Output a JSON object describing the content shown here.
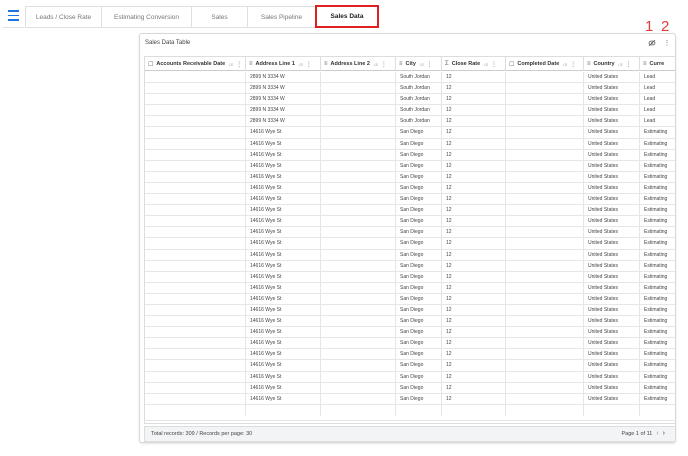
{
  "tabs": [
    {
      "label": "Leads / Close Rate",
      "active": false
    },
    {
      "label": "Estimating Conversion",
      "active": false
    },
    {
      "label": "Sales",
      "active": false
    },
    {
      "label": "Sales Pipeline",
      "active": false
    },
    {
      "label": "Sales Data",
      "active": true
    }
  ],
  "annotations": {
    "first": "1",
    "second": "2"
  },
  "card": {
    "title": "Sales Data Table",
    "visibility_icon": "eye-slash-icon",
    "more_icon": "kebab-icon"
  },
  "table": {
    "columns": [
      {
        "label": "Accounts Receivable Date",
        "icon": "☐",
        "sortable": true
      },
      {
        "label": "Address Line 1",
        "icon": "≡",
        "sortable": true
      },
      {
        "label": "Address Line 2",
        "icon": "≡",
        "sortable": true
      },
      {
        "label": "City",
        "icon": "≡",
        "sortable": true
      },
      {
        "label": "Close Rate",
        "icon": "Σ",
        "sortable": true
      },
      {
        "label": "Completed Date",
        "icon": "☐",
        "sortable": true
      },
      {
        "label": "Country",
        "icon": "≡",
        "sortable": true
      },
      {
        "label": "Curre",
        "icon": "≡",
        "sortable": false
      }
    ],
    "sort_glyph": "↓≡",
    "kebab_glyph": "⋮",
    "rows": [
      [
        "",
        "2899 N 3334 W",
        "",
        "South Jordan",
        "12",
        "",
        "United States",
        "Lead"
      ],
      [
        "",
        "2899 N 3334 W",
        "",
        "South Jordan",
        "12",
        "",
        "United States",
        "Lead"
      ],
      [
        "",
        "2899 N 3334 W",
        "",
        "South Jordan",
        "12",
        "",
        "United States",
        "Lead"
      ],
      [
        "",
        "2899 N 3334 W",
        "",
        "South Jordan",
        "12",
        "",
        "United States",
        "Lead"
      ],
      [
        "",
        "2899 N 3334 W",
        "",
        "South Jordan",
        "12",
        "",
        "United States",
        "Lead"
      ],
      [
        "",
        "14616 Wye St",
        "",
        "San Diego",
        "12",
        "",
        "United States",
        "Estimating"
      ],
      [
        "",
        "14616 Wye St",
        "",
        "San Diego",
        "12",
        "",
        "United States",
        "Estimating"
      ],
      [
        "",
        "14616 Wye St",
        "",
        "San Diego",
        "12",
        "",
        "United States",
        "Estimating"
      ],
      [
        "",
        "14616 Wye St",
        "",
        "San Diego",
        "12",
        "",
        "United States",
        "Estimating"
      ],
      [
        "",
        "14616 Wye St",
        "",
        "San Diego",
        "12",
        "",
        "United States",
        "Estimating"
      ],
      [
        "",
        "14616 Wye St",
        "",
        "San Diego",
        "12",
        "",
        "United States",
        "Estimating"
      ],
      [
        "",
        "14616 Wye St",
        "",
        "San Diego",
        "12",
        "",
        "United States",
        "Estimating"
      ],
      [
        "",
        "14616 Wye St",
        "",
        "San Diego",
        "12",
        "",
        "United States",
        "Estimating"
      ],
      [
        "",
        "14616 Wye St",
        "",
        "San Diego",
        "12",
        "",
        "United States",
        "Estimating"
      ],
      [
        "",
        "14616 Wye St",
        "",
        "San Diego",
        "12",
        "",
        "United States",
        "Estimating"
      ],
      [
        "",
        "14616 Wye St",
        "",
        "San Diego",
        "12",
        "",
        "United States",
        "Estimating"
      ],
      [
        "",
        "14616 Wye St",
        "",
        "San Diego",
        "12",
        "",
        "United States",
        "Estimating"
      ],
      [
        "",
        "14616 Wye St",
        "",
        "San Diego",
        "12",
        "",
        "United States",
        "Estimating"
      ],
      [
        "",
        "14616 Wye St",
        "",
        "San Diego",
        "12",
        "",
        "United States",
        "Estimating"
      ],
      [
        "",
        "14616 Wye St",
        "",
        "San Diego",
        "12",
        "",
        "United States",
        "Estimating"
      ],
      [
        "",
        "14616 Wye St",
        "",
        "San Diego",
        "12",
        "",
        "United States",
        "Estimating"
      ],
      [
        "",
        "14616 Wye St",
        "",
        "San Diego",
        "12",
        "",
        "United States",
        "Estimating"
      ],
      [
        "",
        "14616 Wye St",
        "",
        "San Diego",
        "12",
        "",
        "United States",
        "Estimating"
      ],
      [
        "",
        "14616 Wye St",
        "",
        "San Diego",
        "12",
        "",
        "United States",
        "Estimating"
      ],
      [
        "",
        "14616 Wye St",
        "",
        "San Diego",
        "12",
        "",
        "United States",
        "Estimating"
      ],
      [
        "",
        "14616 Wye St",
        "",
        "San Diego",
        "12",
        "",
        "United States",
        "Estimating"
      ],
      [
        "",
        "14616 Wye St",
        "",
        "San Diego",
        "12",
        "",
        "United States",
        "Estimating"
      ],
      [
        "",
        "14616 Wye St",
        "",
        "San Diego",
        "12",
        "",
        "United States",
        "Estimating"
      ],
      [
        "",
        "14616 Wye St",
        "",
        "San Diego",
        "12",
        "",
        "United States",
        "Estimating"
      ],
      [
        "",
        "14616 Wye St",
        "",
        "San Diego",
        "12",
        "",
        "United States",
        "Estimating"
      ]
    ]
  },
  "footer": {
    "total_label": "Total records:",
    "total": "309",
    "separator": "/",
    "per_page_label": "Records per page:",
    "per_page": "30",
    "page_label": "Page 1 of 11",
    "prev_glyph": "‹",
    "next_glyph": "›"
  }
}
